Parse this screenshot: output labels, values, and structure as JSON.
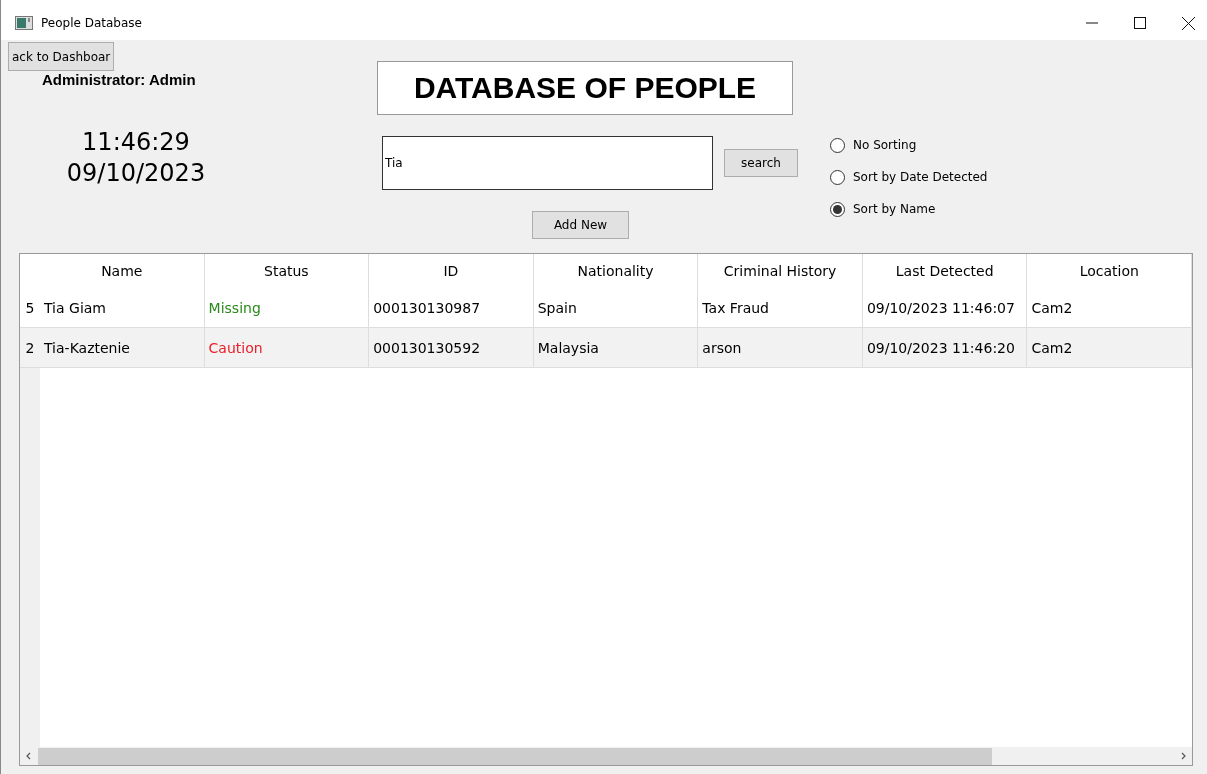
{
  "window": {
    "title": "People Database"
  },
  "back_button": {
    "label": "ack to Dashboar"
  },
  "admin_label": "Administrator: Admin",
  "clock": {
    "time": "11:46:29",
    "date": "09/10/2023"
  },
  "title": "DATABASE OF PEOPLE",
  "search": {
    "value": "Tia",
    "button": "search"
  },
  "add_button": "Add New",
  "sorting": [
    {
      "label": "No Sorting",
      "selected": false
    },
    {
      "label": "Sort by Date Detected",
      "selected": false
    },
    {
      "label": "Sort by Name",
      "selected": true
    }
  ],
  "table": {
    "columns": [
      "Name",
      "Status",
      "ID",
      "Nationality",
      "Criminal History",
      "Last Detected",
      "Location"
    ],
    "rows": [
      {
        "row_number": "5",
        "cells": [
          "Tia Giam",
          "Missing",
          "000130130987",
          "Spain",
          "Tax Fraud",
          "09/10/2023 11:46:07",
          "Cam2"
        ],
        "color": "#2a8a1a"
      },
      {
        "row_number": "2",
        "cells": [
          "Tia-Kaztenie",
          "Caution",
          "000130130592",
          "Malaysia",
          "arson",
          "09/10/2023 11:46:20",
          "Cam2"
        ],
        "color": "#e8202a"
      }
    ]
  }
}
